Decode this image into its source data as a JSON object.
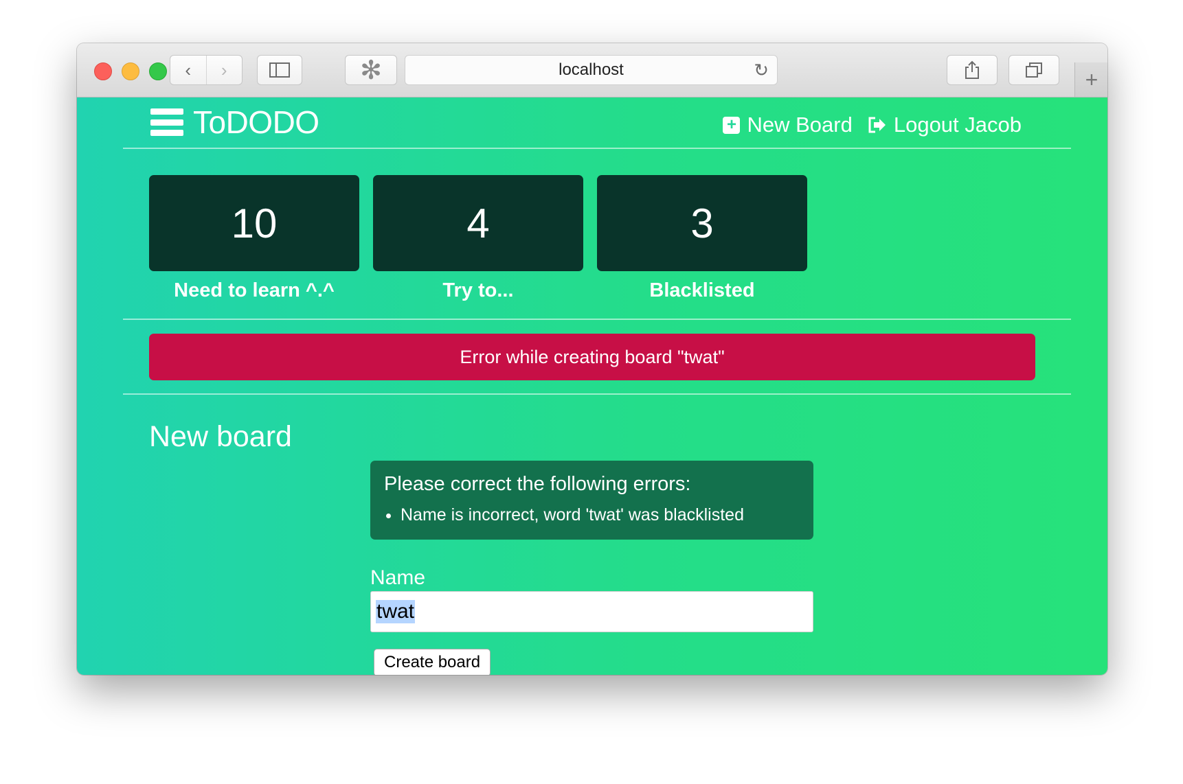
{
  "browser": {
    "url": "localhost"
  },
  "app": {
    "brand": "ToDODO",
    "nav": {
      "new_board": "New Board",
      "logout": "Logout Jacob"
    }
  },
  "stats": [
    {
      "value": "10",
      "label": "Need to learn ^.^"
    },
    {
      "value": "4",
      "label": "Try to..."
    },
    {
      "value": "3",
      "label": "Blacklisted"
    }
  ],
  "flash_error": "Error while creating board \"twat\"",
  "section_title": "New board",
  "errors": {
    "heading": "Please correct the following errors:",
    "items": [
      "Name is incorrect, word 'twat' was blacklisted"
    ]
  },
  "form": {
    "name_label": "Name",
    "name_value": "twat",
    "submit_label": "Create board"
  },
  "colors": {
    "page_gradient_start": "#21d3b0",
    "page_gradient_end": "#26e27a",
    "stat_box": "#09342a",
    "error_banner": "#c70f46",
    "errors_panel": "#13714d"
  }
}
